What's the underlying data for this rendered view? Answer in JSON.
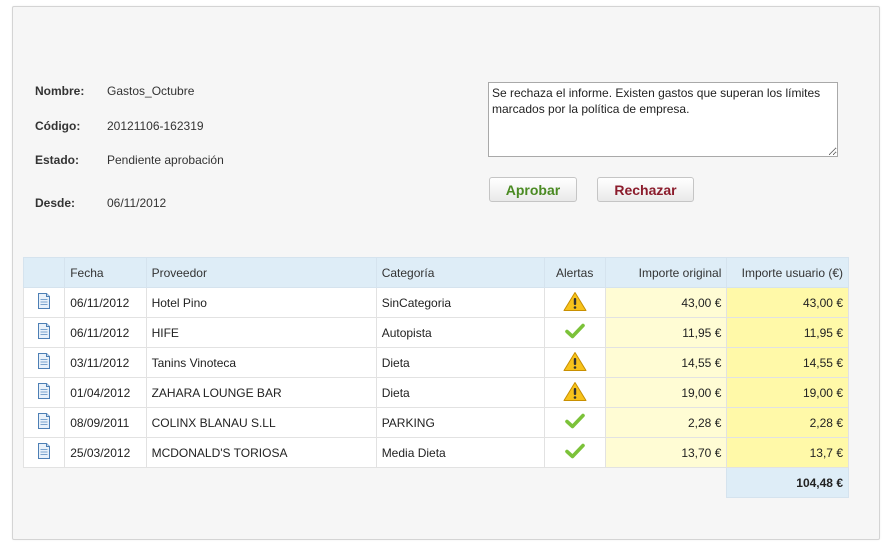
{
  "report": {
    "fields": [
      {
        "label": "Nombre:",
        "value": "Gastos_Octubre"
      },
      {
        "label": "Código:",
        "value": "20121106-162319"
      },
      {
        "label": "Estado:",
        "value": "Pendiente aprobación"
      },
      {
        "label": "Desde:",
        "value": "06/11/2012"
      }
    ]
  },
  "comment": {
    "value": "Se rechaza el informe. Existen gastos que superan los límites marcados por la política de empresa."
  },
  "actions": {
    "approve_label": "Aprobar",
    "reject_label": "Rechazar"
  },
  "table": {
    "headers": [
      "",
      "Fecha",
      "Proveedor",
      "Categoría",
      "Alertas",
      "Importe original",
      "Importe usuario (€)"
    ],
    "rows": [
      {
        "icon": "document-icon",
        "date": "06/11/2012",
        "provider": "Hotel Pino",
        "category": "SinCategoria",
        "alert": "warning-icon",
        "original": "43,00 €",
        "user": "43,00 €"
      },
      {
        "icon": "document-icon",
        "date": "06/11/2012",
        "provider": "HIFE",
        "category": "Autopista",
        "alert": "check-icon",
        "original": "11,95 €",
        "user": "11,95 €"
      },
      {
        "icon": "document-icon",
        "date": "03/11/2012",
        "provider": "Tanins Vinoteca",
        "category": "Dieta",
        "alert": "warning-icon",
        "original": "14,55 €",
        "user": "14,55 €"
      },
      {
        "icon": "document-icon",
        "date": "01/04/2012",
        "provider": "ZAHARA LOUNGE BAR",
        "category": "Dieta",
        "alert": "warning-icon",
        "original": "19,00 €",
        "user": "19,00 €"
      },
      {
        "icon": "document-icon",
        "date": "08/09/2011",
        "provider": "COLINX BLANAU S.LL",
        "category": "PARKING",
        "alert": "check-icon",
        "original": "2,28 €",
        "user": "2,28 €"
      },
      {
        "icon": "document-icon",
        "date": "25/03/2012",
        "provider": "MCDONALD'S TORIOSA",
        "category": "Media Dieta",
        "alert": "check-icon",
        "original": "13,70 €",
        "user": "13,7 €"
      }
    ],
    "total": "104,48 €"
  },
  "colors": {
    "header_bg": "#deedf7",
    "original_bg": "#fffcd4",
    "user_bg": "#fff9a8",
    "approve": "#4a8a22",
    "reject": "#8b1c2c",
    "check": "#7cc23a",
    "warning": "#f5b800"
  }
}
